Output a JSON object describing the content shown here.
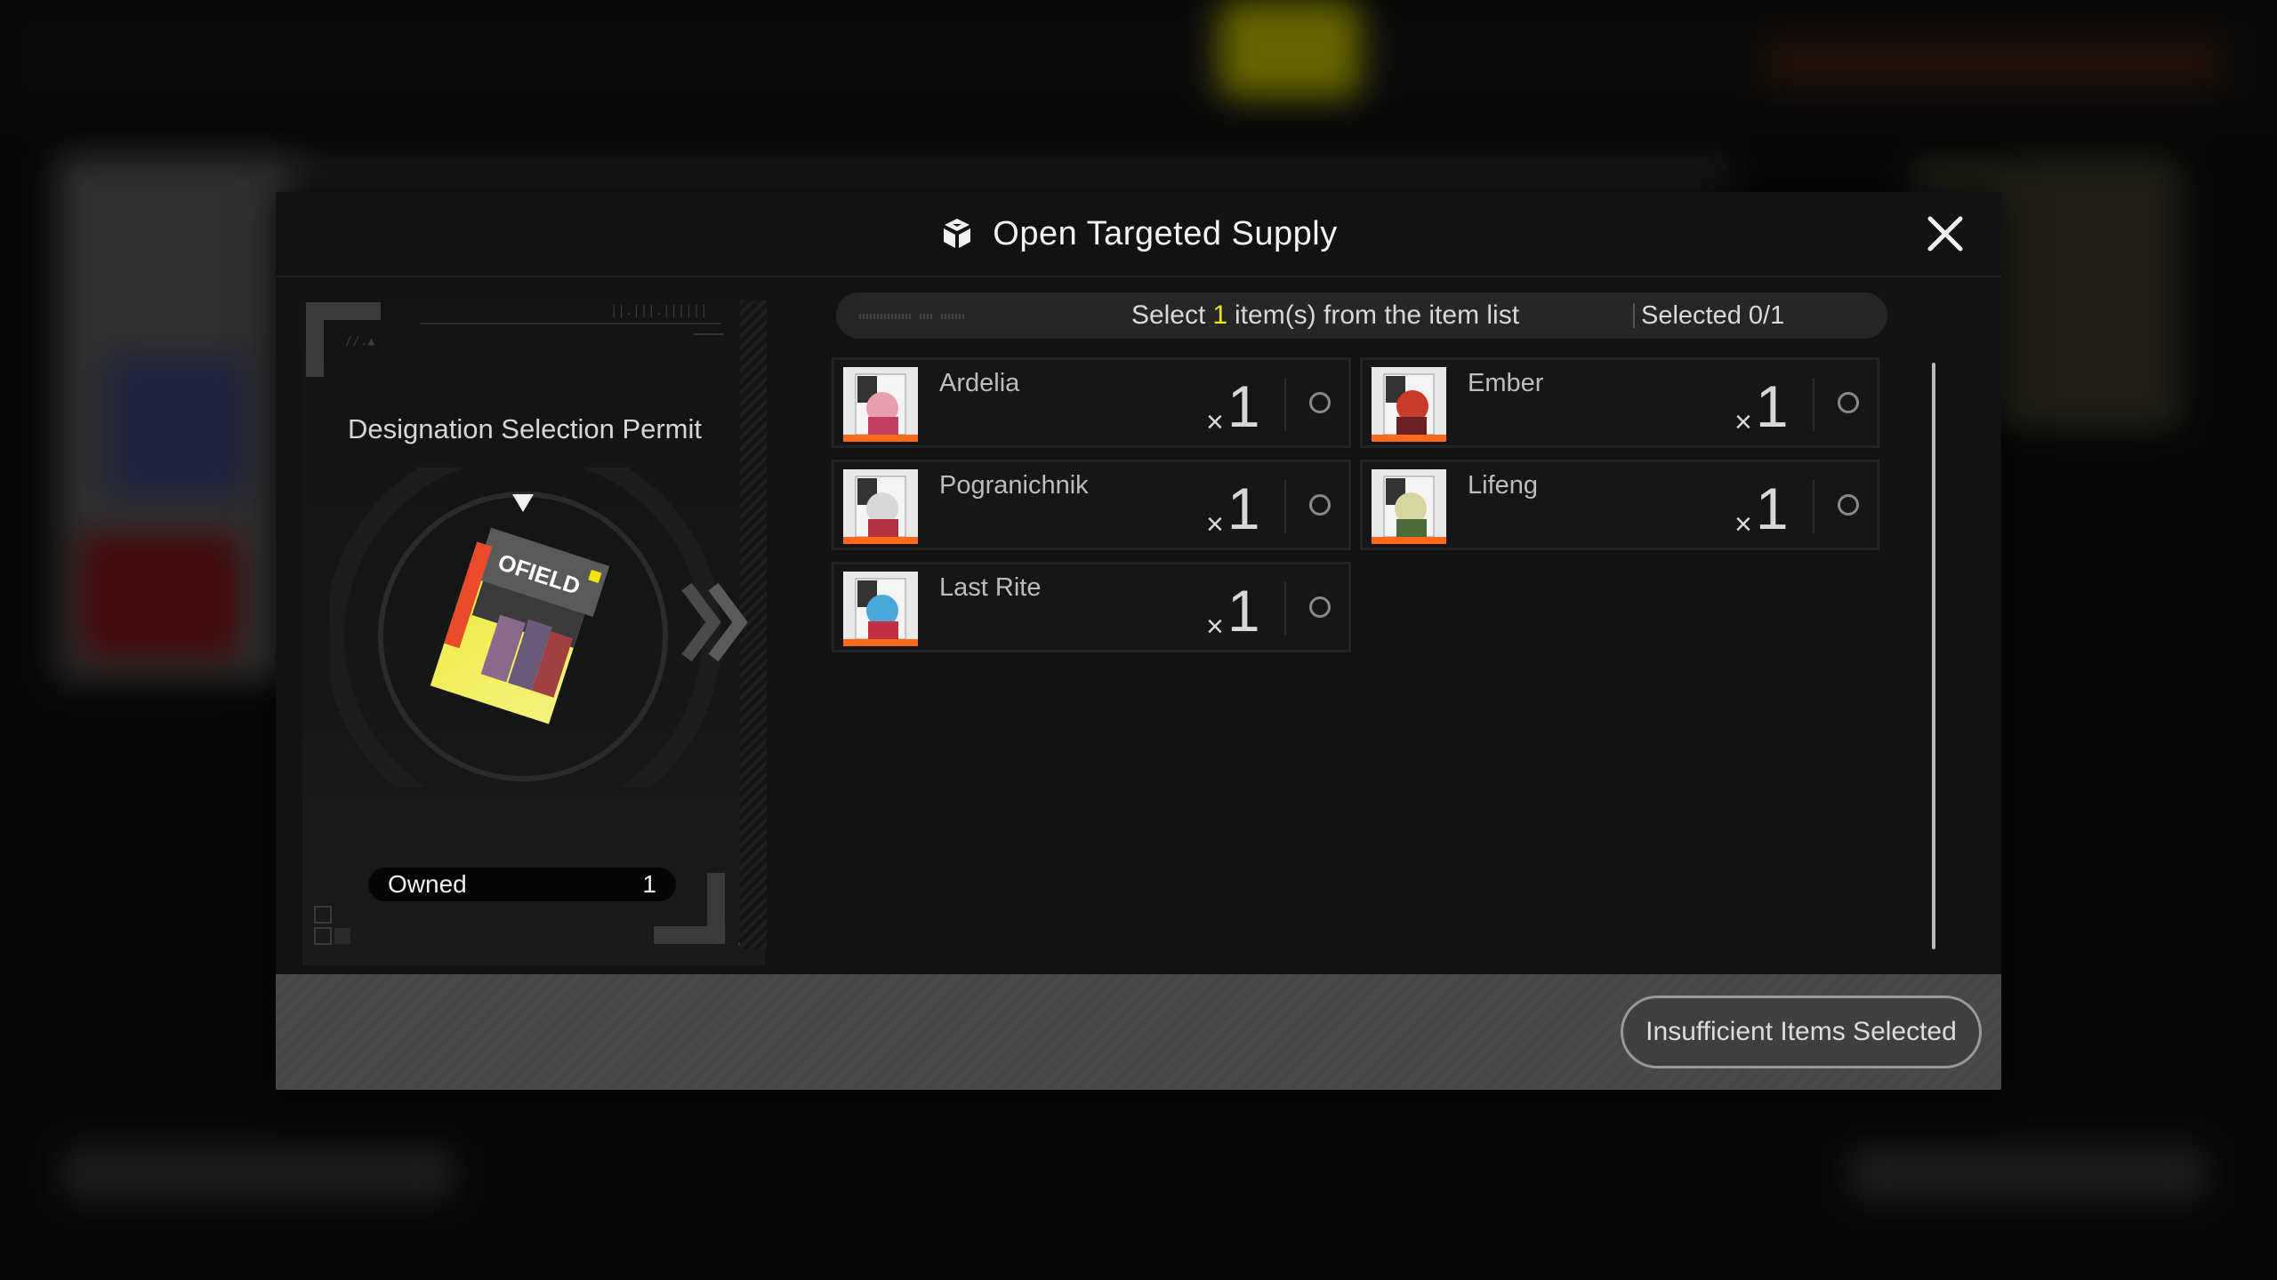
{
  "dialog": {
    "title": "Open Targeted Supply",
    "title_icon": "supply-box-icon",
    "close_icon": "close-icon"
  },
  "permit": {
    "name": "Designation Selection Permit",
    "owned_label": "Owned",
    "owned_count": "1",
    "card_text": "OFIELD"
  },
  "selection": {
    "prefix": "Select",
    "count": "1",
    "suffix": "item(s) from the item list",
    "status": "Selected 0/1"
  },
  "items": [
    {
      "name": "Ardelia",
      "qty_x": "×",
      "qty": "1"
    },
    {
      "name": "Ember",
      "qty_x": "×",
      "qty": "1"
    },
    {
      "name": "Pogranichnik",
      "qty_x": "×",
      "qty": "1"
    },
    {
      "name": "Lifeng",
      "qty_x": "×",
      "qty": "1"
    },
    {
      "name": "Last Rite",
      "qty_x": "×",
      "qty": "1"
    }
  ],
  "footer": {
    "confirm_label": "Insufficient Items Selected"
  },
  "colors": {
    "accent_yellow": "#f4e400",
    "thumb_orange": "#ff6a1a"
  }
}
